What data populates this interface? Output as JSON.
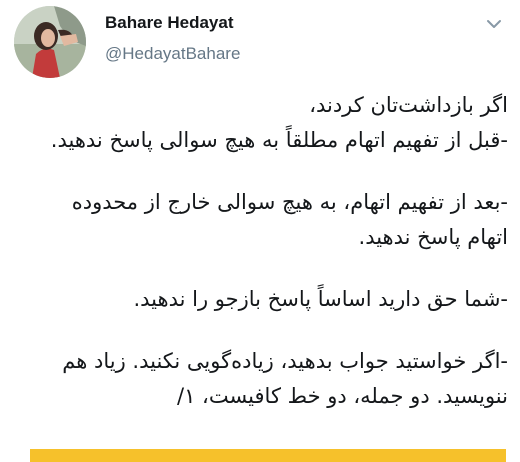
{
  "author": {
    "name": "Bahare Hedayat",
    "handle": "@HedayatBahare"
  },
  "icons": {
    "avatar": "profile-photo",
    "menu": "chevron-down-icon"
  },
  "colors": {
    "handle": "#657786",
    "text": "#14171a",
    "card_strip": "#f6c12b"
  },
  "tweet": {
    "lines": [
      "اگر بازداشت‌تان کردند،",
      "-قبل از تفهیم اتهام مطلقاً به هیچ سوالی پاسخ ندهید.",
      "-بعد از تفهیم اتهام، به هیچ سوالی خارج از محدوده",
      "اتهام پاسخ ندهید.",
      "-شما حق دارید اساساً پاسخ بازجو را ندهید.",
      "-اگر خواستید جواب بدهید، زیاده‌گویی نکنید. زیاد هم",
      "ننویسید. دو جمله، دو خط کافیست، ۱/"
    ]
  }
}
